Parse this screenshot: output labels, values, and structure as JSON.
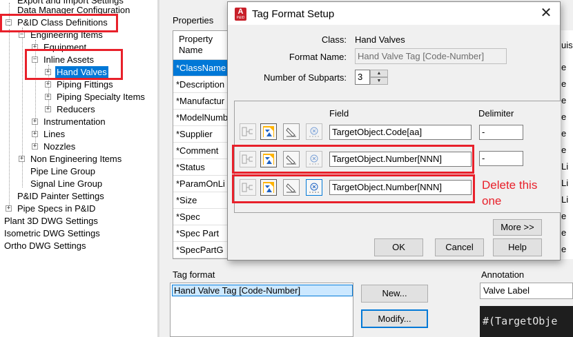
{
  "tree": {
    "items": [
      {
        "label": "Export and Import Settings"
      },
      {
        "label": "Data Manager Configuration"
      },
      {
        "label": "P&ID Class Definitions"
      },
      {
        "label": "Engineering Items"
      },
      {
        "label": "Equipment"
      },
      {
        "label": "Inline Assets"
      },
      {
        "label": "Hand Valves"
      },
      {
        "label": "Piping Fittings"
      },
      {
        "label": "Piping Specialty Items"
      },
      {
        "label": "Reducers"
      },
      {
        "label": "Instrumentation"
      },
      {
        "label": "Lines"
      },
      {
        "label": "Nozzles"
      },
      {
        "label": "Non Engineering Items"
      },
      {
        "label": "Pipe Line Group"
      },
      {
        "label": "Signal Line Group"
      },
      {
        "label": "P&ID Painter Settings"
      },
      {
        "label": "Pipe Specs in P&ID"
      },
      {
        "label": "Plant 3D DWG Settings"
      },
      {
        "label": "Isometric DWG Settings"
      },
      {
        "label": "Ortho DWG Settings"
      }
    ],
    "expand_collapsed": "+",
    "expand_open": "−"
  },
  "properties": {
    "label": "Properties",
    "header_line1": "Property",
    "header_line2": "Name",
    "rows": [
      "*ClassName",
      "*Description",
      "*Manufactur",
      "*ModelNumb",
      "*Supplier",
      "*Comment",
      "*Status",
      "*ParamOnLi",
      "*Size",
      "*Spec",
      "*Spec Part",
      "*SpecPartG"
    ],
    "right_col_header": "uisi",
    "right_col": [
      "e",
      "e",
      "e",
      "e",
      "e",
      "e",
      "Li",
      "Li",
      "Li",
      "e",
      "e",
      "e"
    ]
  },
  "tag_format": {
    "label": "Tag format",
    "items": [
      "Hand Valve Tag [Code-Number]"
    ],
    "new_button": "New...",
    "modify_button": "Modify..."
  },
  "annotation": {
    "label": "Annotation",
    "selected": "Valve Label",
    "preview": "#(TargetObje"
  },
  "dialog": {
    "title": "Tag Format Setup",
    "app_icon_letter": "A",
    "app_icon_sub": "P&ID",
    "close_glyph": "✕",
    "class_label": "Class:",
    "class_value": "Hand Valves",
    "format_name_label": "Format Name:",
    "format_name_value": "Hand Valve Tag [Code-Number]",
    "subparts_label": "Number of Subparts:",
    "subparts_value": "3",
    "field_header": "Field",
    "delimiter_header": "Delimiter",
    "subparts": [
      {
        "field": "TargetObject.Code[aa]",
        "delimiter": "-"
      },
      {
        "field": "TargetObject.Number[NNN]",
        "delimiter": "-"
      },
      {
        "field": "TargetObject.Number[NNN]",
        "delimiter": ""
      }
    ],
    "more_button": "More >>",
    "ok_button": "OK",
    "cancel_button": "Cancel",
    "help_button": "Help",
    "spin_up": "▲",
    "spin_down": "▼"
  },
  "annotation_note": {
    "text": "Delete this one",
    "color": "#e8202a"
  },
  "colors": {
    "selection": "#0078d7",
    "highlight_box": "#e8202a"
  }
}
